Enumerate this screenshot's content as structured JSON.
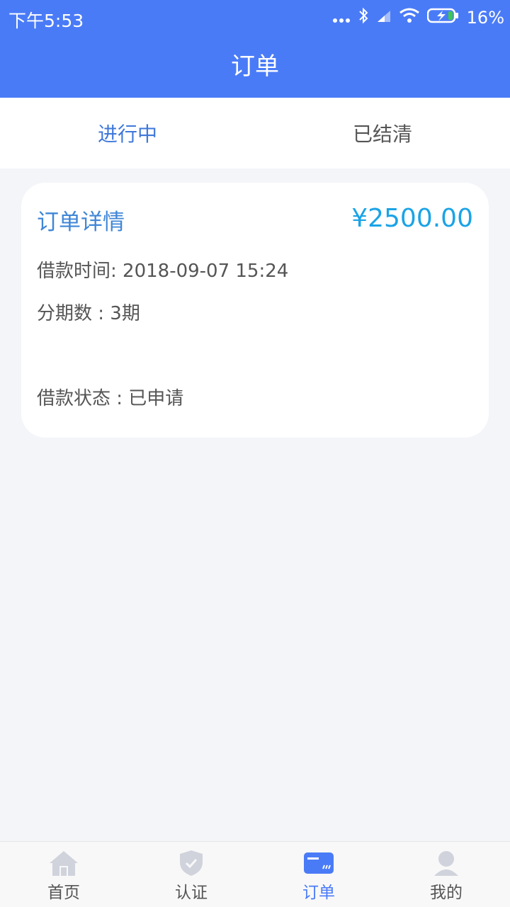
{
  "status_bar": {
    "time": "下午5:53",
    "battery": "16%"
  },
  "header": {
    "title": "订单"
  },
  "tabs": [
    {
      "label": "进行中",
      "active": true
    },
    {
      "label": "已结清",
      "active": false
    }
  ],
  "order": {
    "title": "订单详情",
    "amount": "¥2500.00",
    "loan_time": "借款时间: 2018-09-07 15:24",
    "installments": "分期数 : 3期",
    "status": "借款状态 : 已申请"
  },
  "bottom_nav": [
    {
      "label": "首页",
      "icon": "home-icon"
    },
    {
      "label": "认证",
      "icon": "shield-check-icon"
    },
    {
      "label": "订单",
      "icon": "card-icon"
    },
    {
      "label": "我的",
      "icon": "user-icon"
    }
  ],
  "colors": {
    "primary": "#4a7bf7",
    "amount": "#1ba3e6",
    "background": "#f4f5f9"
  }
}
